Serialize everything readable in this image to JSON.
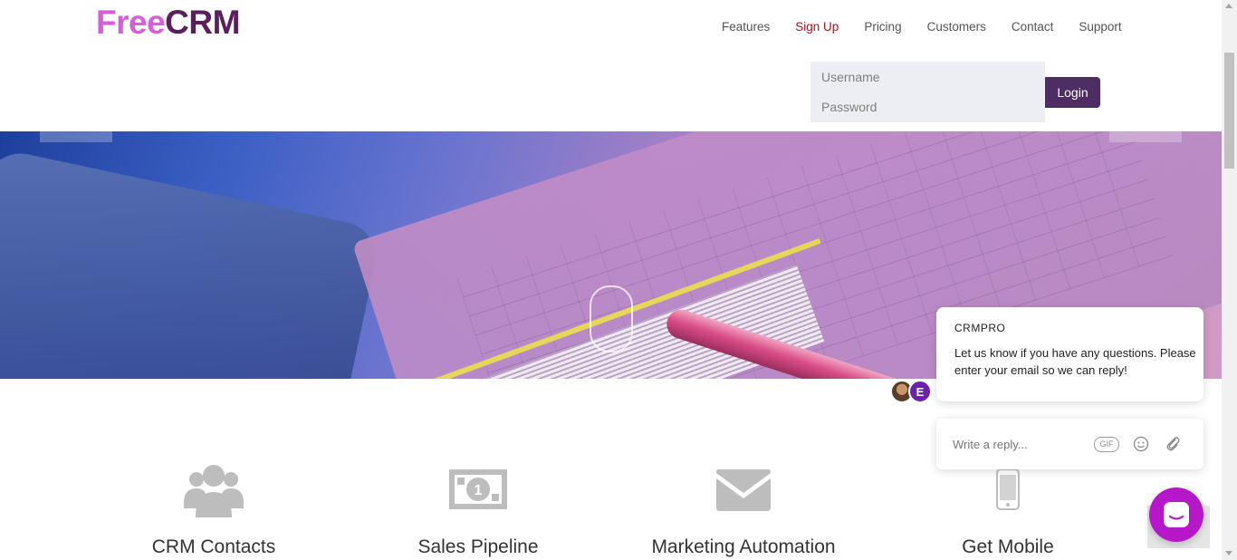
{
  "logo": {
    "part1": "Free",
    "part2": "CRM"
  },
  "nav": {
    "items": [
      {
        "label": "Features"
      },
      {
        "label": "Sign Up"
      },
      {
        "label": "Pricing"
      },
      {
        "label": "Customers"
      },
      {
        "label": "Contact"
      },
      {
        "label": "Support"
      }
    ]
  },
  "login": {
    "username_placeholder": "Username",
    "password_placeholder": "Password",
    "button_label": "Login"
  },
  "features": [
    {
      "title": "CRM Contacts",
      "icon": "users-icon"
    },
    {
      "title": "Sales Pipeline",
      "icon": "money-icon"
    },
    {
      "title": "Marketing Automation",
      "icon": "envelope-icon"
    },
    {
      "title": "Get Mobile",
      "icon": "mobile-icon"
    }
  ],
  "chat": {
    "brand": "CRMPRO",
    "message": "Let us know if you have any questions. Please enter your email so we can reply!",
    "avatar_letter": "E",
    "reply_placeholder": "Write a reply...",
    "gif_label": "GIF"
  },
  "colors": {
    "logo_free": "#d65ed8",
    "logo_crm": "#5a1f5c",
    "nav_active": "#b10f1f",
    "login_button": "#4e2d63",
    "chat_launcher": "#b517c9"
  }
}
